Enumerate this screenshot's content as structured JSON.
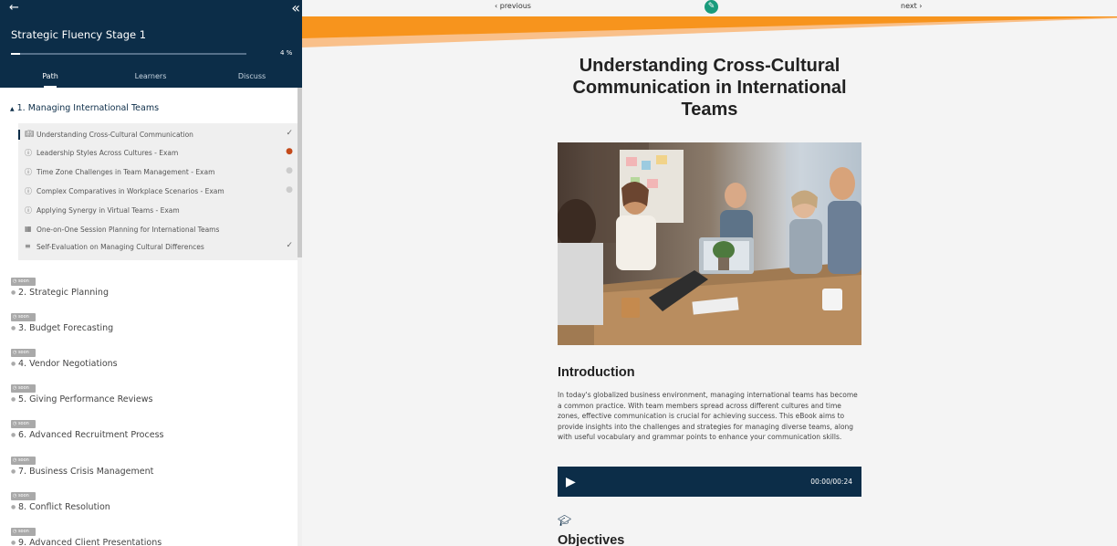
{
  "sidebar": {
    "back_icon": "arrow-left-icon",
    "collapse_icon": "double-chevron-left-icon",
    "course_title": "Strategic Fluency Stage 1",
    "progress_percent": 4,
    "progress_label": "4 %",
    "tabs": [
      {
        "label": "Path",
        "active": true
      },
      {
        "label": "Learners",
        "active": false
      },
      {
        "label": "Discuss",
        "active": false
      }
    ],
    "current_module": {
      "title": "1. Managing International Teams",
      "lessons": [
        {
          "icon": "book-icon",
          "label": "Understanding Cross-Cultural Communication",
          "status": "done",
          "status_glyph": "✓"
        },
        {
          "icon": "question-icon",
          "label": "Leadership Styles Across Cultures - Exam",
          "status": "in-progress",
          "status_glyph": "●"
        },
        {
          "icon": "question-icon",
          "label": "Time Zone Challenges in Team Management - Exam",
          "status": "pending",
          "status_glyph": "●"
        },
        {
          "icon": "question-icon",
          "label": "Complex Comparatives in Workplace Scenarios - Exam",
          "status": "pending",
          "status_glyph": "●"
        },
        {
          "icon": "question-icon",
          "label": "Applying Synergy in Virtual Teams - Exam",
          "status": "none",
          "status_glyph": ""
        },
        {
          "icon": "calendar-icon",
          "label": "One-on-One Session Planning for International Teams",
          "status": "none",
          "status_glyph": ""
        },
        {
          "icon": "checklist-icon",
          "label": "Self-Evaluation on Managing Cultural Differences",
          "status": "done",
          "status_glyph": "✓"
        }
      ]
    },
    "soon_badge": "soon",
    "upcoming_modules": [
      "2. Strategic Planning",
      "3. Budget Forecasting",
      "4. Vendor Negotiations",
      "5. Giving Performance Reviews",
      "6. Advanced Recruitment Process",
      "7. Business Crisis Management",
      "8. Conflict Resolution",
      "9. Advanced Client Presentations"
    ]
  },
  "main": {
    "nav": {
      "previous": "‹ previous",
      "next": "next ›"
    },
    "edit_icon": "pencil-icon",
    "colors": {
      "navy": "#0c2d48",
      "accent_orange": "#f7941d",
      "accent_light": "#f9b66a",
      "edit_green": "#1a9b7c"
    },
    "title": "Understanding Cross-Cultural Communication in International Teams",
    "hero_image": "business-team-meeting-photo",
    "intro_heading": "Introduction",
    "intro_text": "In today's globalized business environment, managing international teams has become a common practice. With team members spread across different cultures and time zones, effective communication is crucial for achieving success. This eBook aims to provide insights into the challenges and strategies for managing diverse teams, along with useful vocabulary and grammar points to enhance your communication skills.",
    "audio": {
      "time": "00:00/00:24",
      "play_icon": "play-icon"
    },
    "objectives_icon": "graduation-cap-icon",
    "objectives_heading": "Objectives"
  }
}
